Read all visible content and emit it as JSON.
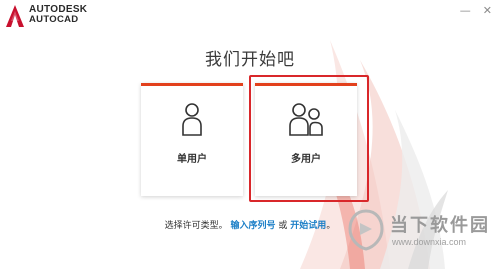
{
  "brand": {
    "line1": "AUTODESK",
    "line2": "AUTOCAD",
    "logo_icon": "autocad-a-logo",
    "accent": "#e2401c"
  },
  "window": {
    "minimize": "—",
    "close": "✕"
  },
  "title": "我们开始吧",
  "cards": [
    {
      "label": "单用户",
      "icon": "single-user-icon"
    },
    {
      "label": "多用户",
      "icon": "multi-user-icon",
      "highlighted": true
    }
  ],
  "license": {
    "prompt": "选择许可类型。",
    "link_serial": "输入序列号",
    "or": " 或 ",
    "link_trial": "开始试用",
    "end": "。"
  },
  "watermark": {
    "name": "当下软件园",
    "url": "www.downxia.com"
  },
  "colors": {
    "accent_red": "#e2401c",
    "focus_red": "#d9272a",
    "link_blue": "#1c7fc7"
  }
}
